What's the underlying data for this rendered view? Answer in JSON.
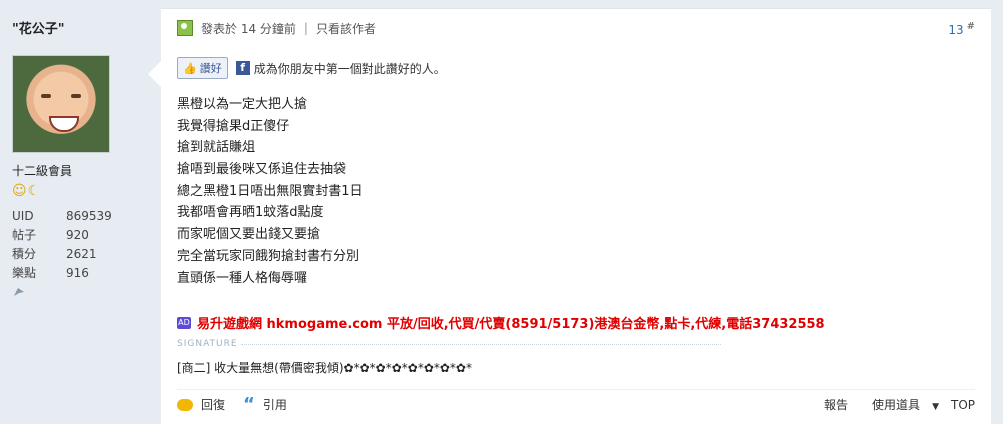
{
  "user": {
    "name": "\"花公子\"",
    "rank": "十二級會員",
    "medals": "☺☾",
    "stats": [
      {
        "label": "UID",
        "value": "869539"
      },
      {
        "label": "帖子",
        "value": "920"
      },
      {
        "label": "積分",
        "value": "2621"
      },
      {
        "label": "樂點",
        "value": "916"
      }
    ]
  },
  "post": {
    "posted": "發表於 14 分鐘前",
    "author_only": "只看該作者",
    "floor": "13",
    "floor_mark": "#",
    "like_label": "讚好",
    "like_text": "成為你朋友中第一個對此讚好的人。",
    "fb": "f",
    "lines": [
      "黑橙以為一定大把人搶",
      "我覺得搶果d正傻仔",
      "搶到就話賺俎",
      "搶唔到最後咪又係追住去抽袋",
      "總之黑橙1日唔出無限實封書1日",
      "我都唔會再晒1蚊落d點度",
      "而家呢個又要出錢又要搶",
      "完全當玩家同餓狗搶封書冇分別",
      "直頭係一種人格侮辱囉"
    ],
    "ad_badge": "AD",
    "ad_text": "易升遊戲網 hkmogame.com 平放/回收,代買/代賣(8591/5173)港澳台金幣,點卡,代練,電話37432558",
    "signature_label": "SIGNATURE",
    "signature": "[商二] 收大量無想(帶價密我傾)✿*✿*✿*✿*✿*✿*✿*✿*"
  },
  "footer": {
    "reply": "回復",
    "quote": "引用",
    "report": "報告",
    "tools": "使用道具",
    "top": "TOP"
  }
}
